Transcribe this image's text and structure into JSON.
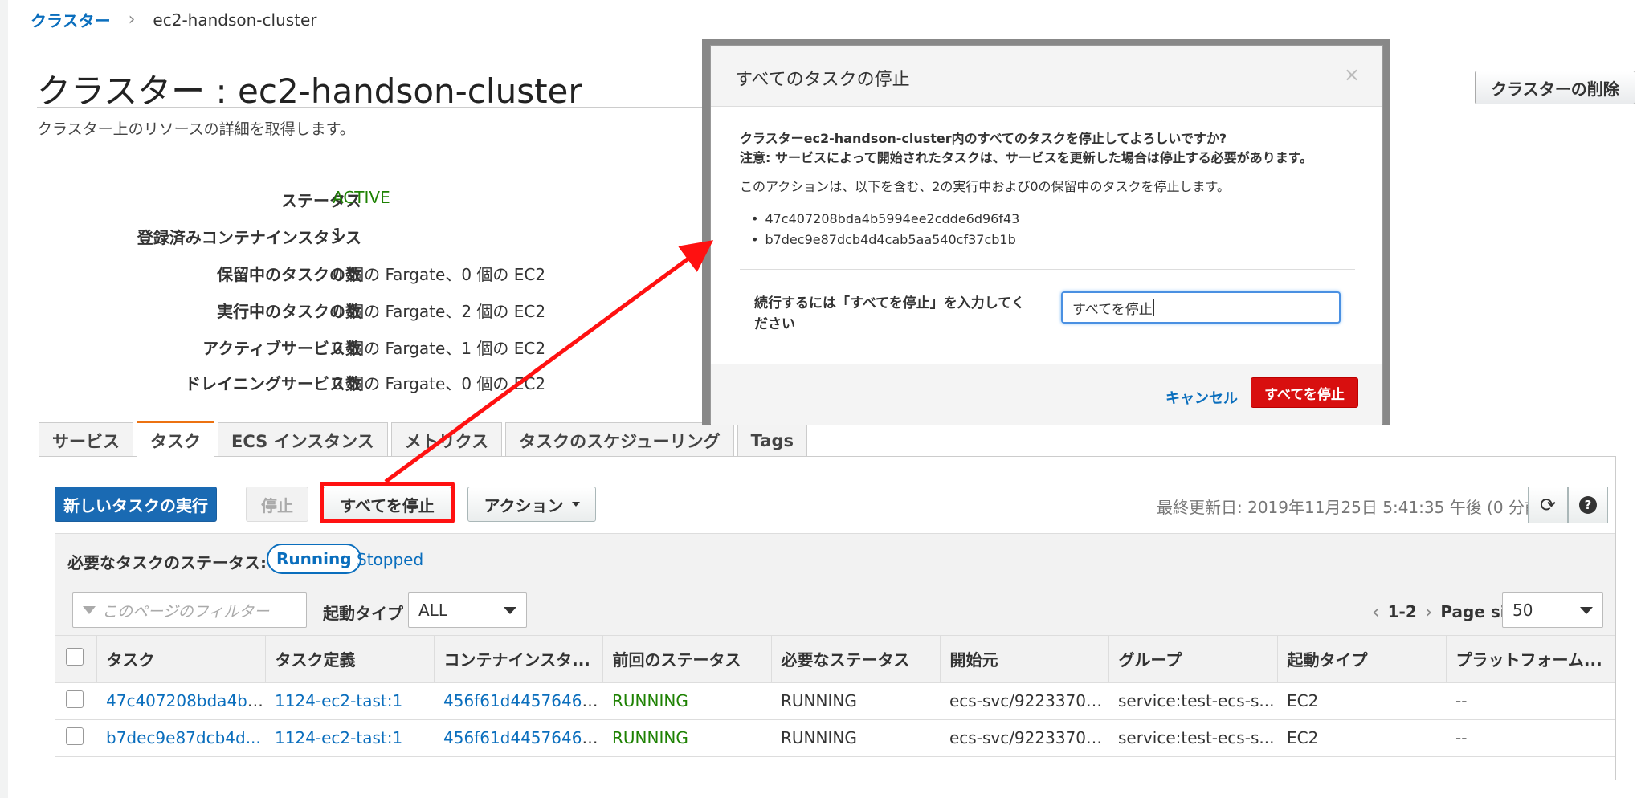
{
  "breadcrumb": {
    "root": "クラスター",
    "separator": "›",
    "current": "ec2-handson-cluster"
  },
  "page": {
    "title": "クラスター : ec2-handson-cluster",
    "subtitle": "クラスター上のリソースの詳細を取得します。",
    "delete_button": "クラスターの削除"
  },
  "details": [
    {
      "label": "ステータス",
      "value": "ACTIVE"
    },
    {
      "label": "登録済みコンテナインスタンス",
      "value": "1"
    },
    {
      "label": "保留中のタスクの数",
      "value": "0 個の Fargate、0 個の EC2"
    },
    {
      "label": "実行中のタスクの数",
      "value": "0 個の Fargate、2 個の EC2"
    },
    {
      "label": "アクティブサービス数",
      "value": "0 個の Fargate、1 個の EC2"
    },
    {
      "label": "ドレイニングサービス数",
      "value": "0 個の Fargate、0 個の EC2"
    }
  ],
  "tabs": [
    "サービス",
    "タスク",
    "ECS インスタンス",
    "メトリクス",
    "タスクのスケジューリング",
    "Tags"
  ],
  "toolbar": {
    "run_task": "新しいタスクの実行",
    "stop": "停止",
    "stop_all": "すべてを停止",
    "actions": "アクション",
    "last_updated": "最終更新日: 2019年11月25日 5:41:35 午後 (0 分前)"
  },
  "status_filter": {
    "label": "必要なタスクのステータス:",
    "running": "Running",
    "stopped": "Stopped"
  },
  "filter": {
    "placeholder": "このページのフィルター",
    "launch_type_label": "起動タイプ",
    "launch_type_value": "ALL",
    "range": "1-2",
    "page_size_label": "Page size",
    "page_size_value": "50"
  },
  "table": {
    "columns": [
      "タスク",
      "タスク定義",
      "コンテナインスタ...",
      "前回のステータス",
      "必要なステータス",
      "開始元",
      "グループ",
      "起動タイプ",
      "プラットフォーム..."
    ],
    "rows": [
      [
        "47c407208bda4b5...",
        "1124-ec2-tast:1",
        "456f61d44576467...",
        "RUNNING",
        "RUNNING",
        "ecs-svc/92233704...",
        "service:test-ecs-s...",
        "EC2",
        "--"
      ],
      [
        "b7dec9e87dcb4d...",
        "1124-ec2-tast:1",
        "456f61d44576467...",
        "RUNNING",
        "RUNNING",
        "ecs-svc/92233704...",
        "service:test-ecs-s...",
        "EC2",
        "--"
      ]
    ]
  },
  "modal": {
    "title": "すべてのタスクの停止",
    "close": "×",
    "question": "クラスターec2-handson-cluster内のすべてのタスクを停止してよろしいですか?",
    "warning": "注意: サービスによって開始されたタスクは、サービスを更新した場合は停止する必要があります。",
    "info": "このアクションは、以下を含む、2の実行中および0の保留中のタスクを停止します。",
    "task_ids": [
      "47c407208bda4b5994ee2cdde6d96f43",
      "b7dec9e87dcb4d4cab5aa540cf37cb1b"
    ],
    "confirm_label": "続行するには「すべてを停止」を入力してください",
    "confirm_value": "すべてを停止",
    "cancel": "キャンセル",
    "submit": "すべてを停止"
  },
  "colors": {
    "primary": "#1a6ab3",
    "danger": "#d80f0f",
    "active": "#1d8102",
    "link": "#0a6ebd",
    "annotation": "#ff1111"
  }
}
